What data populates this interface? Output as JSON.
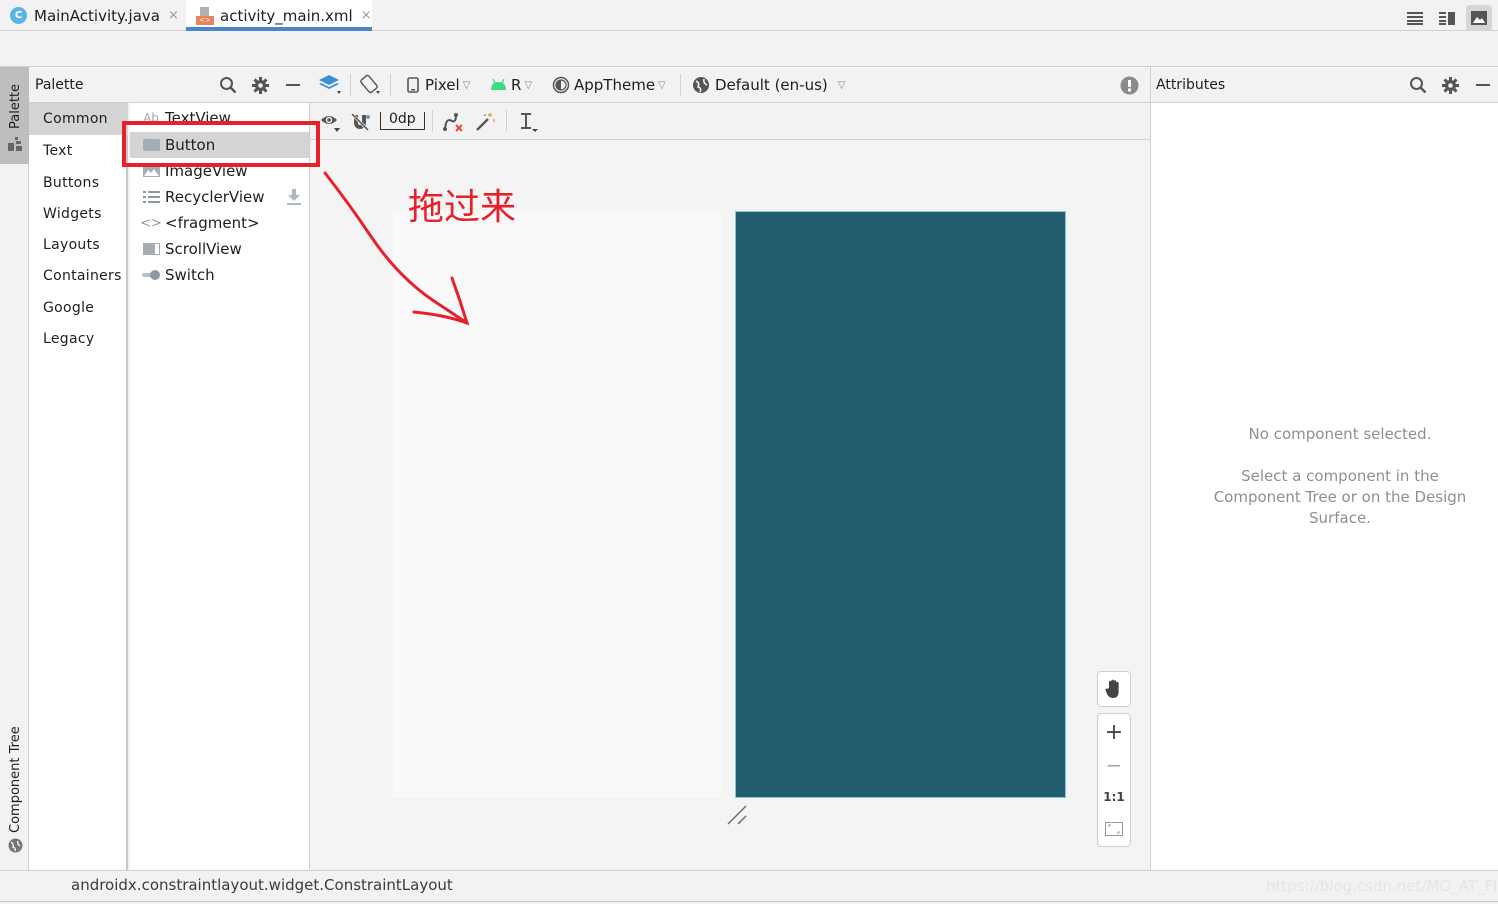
{
  "tabs": [
    {
      "label": "MainActivity.java",
      "icon": "java-class-icon",
      "badge": "C",
      "active": false
    },
    {
      "label": "activity_main.xml",
      "icon": "xml-layout-icon",
      "active": true
    }
  ],
  "tab_close_glyph": "×",
  "view_modes": [
    {
      "name": "code",
      "icon": "code-view-icon",
      "active": false
    },
    {
      "name": "split",
      "icon": "split-view-icon",
      "active": false
    },
    {
      "name": "design",
      "icon": "design-view-icon",
      "active": true
    }
  ],
  "left_strip": {
    "palette_label": "Palette",
    "component_tree_label": "Component Tree"
  },
  "palette": {
    "title": "Palette",
    "categories": [
      {
        "label": "Common",
        "selected": true
      },
      {
        "label": "Text"
      },
      {
        "label": "Buttons"
      },
      {
        "label": "Widgets"
      },
      {
        "label": "Layouts"
      },
      {
        "label": "Containers"
      },
      {
        "label": "Google"
      },
      {
        "label": "Legacy"
      }
    ],
    "items": [
      {
        "label": "TextView",
        "icon": "text-ab-icon",
        "glyph": "Ab"
      },
      {
        "label": "Button",
        "icon": "button-icon",
        "selected": true
      },
      {
        "label": "ImageView",
        "icon": "image-icon"
      },
      {
        "label": "RecyclerView",
        "icon": "list-icon",
        "downloadable": true
      },
      {
        "label": "<fragment>",
        "icon": "code-brackets-icon",
        "glyph": "<>"
      },
      {
        "label": "ScrollView",
        "icon": "scrollview-icon"
      },
      {
        "label": "Switch",
        "icon": "switch-icon"
      }
    ]
  },
  "design_toolbar": {
    "device": "Pixel",
    "api": "R",
    "theme": "AppTheme",
    "locale": "Default (en-us)",
    "margin": "0dp"
  },
  "annotation": {
    "text": "拖过来",
    "color": "#e8202a"
  },
  "zoom_controls": {
    "zoom_in": "+",
    "zoom_out": "−",
    "actual_size": "1:1"
  },
  "attributes": {
    "title": "Attributes",
    "empty_title": "No component selected.",
    "empty_hint": "Select a component in the Component Tree or on the Design Surface."
  },
  "status": {
    "text": "androidx.constraintlayout.widget.ConstraintLayout",
    "watermark": "https://blog.csdn.net/MO_AT_FI"
  },
  "colors": {
    "accent": "#4a86c6",
    "blueprint": "#235e70",
    "highlight": "#e8202a"
  }
}
